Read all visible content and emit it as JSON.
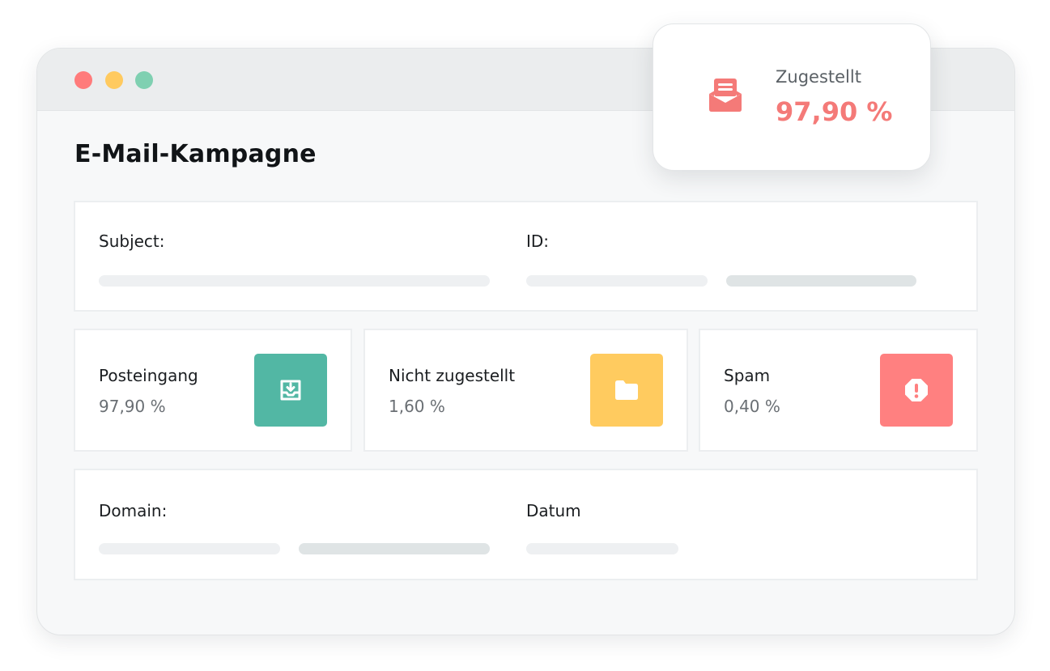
{
  "colors": {
    "dot_red": "#ff7b7b",
    "dot_yellow": "#ffca5f",
    "dot_green": "#7fd0b1",
    "teal": "#52b7a4",
    "yellow": "#ffcb5f",
    "red": "#ff8080",
    "accent": "#f47a78"
  },
  "window": {
    "title": "E-Mail-Kampagne"
  },
  "popup": {
    "icon": "open-envelope-icon",
    "label": "Zugestellt",
    "value": "97,90 %"
  },
  "info_top": {
    "subject_label": "Subject:",
    "id_label": "ID:"
  },
  "stats": [
    {
      "label": "Posteingang",
      "value": "97,90 %",
      "icon": "inbox-download-icon"
    },
    {
      "label": "Nicht zugestellt",
      "value": "1,60 %",
      "icon": "folder-icon"
    },
    {
      "label": "Spam",
      "value": "0,40 %",
      "icon": "alert-icon"
    }
  ],
  "info_bottom": {
    "domain_label": "Domain:",
    "date_label": "Datum"
  }
}
